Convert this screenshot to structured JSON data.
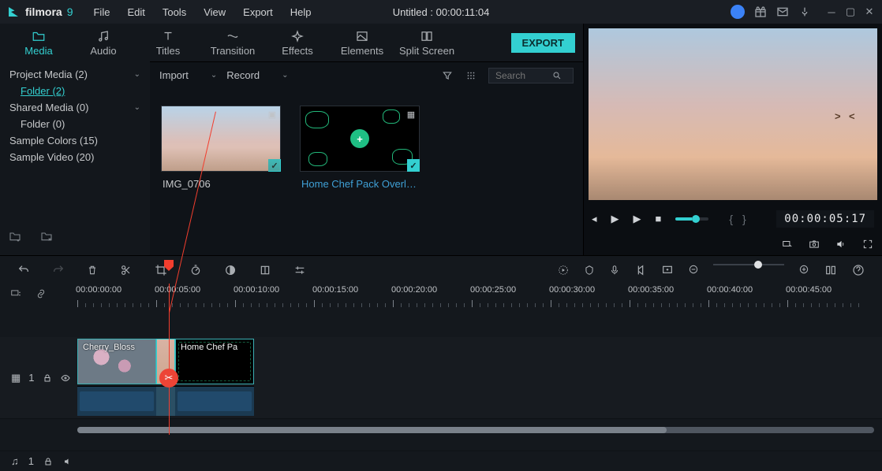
{
  "app": {
    "name": "filmora",
    "num": "9",
    "title": "Untitled : 00:00:11:04"
  },
  "menu": {
    "file": "File",
    "edit": "Edit",
    "tools": "Tools",
    "view": "View",
    "export": "Export",
    "help": "Help"
  },
  "tabs": {
    "media": "Media",
    "audio": "Audio",
    "titles": "Titles",
    "transition": "Transition",
    "effects": "Effects",
    "elements": "Elements",
    "split": "Split Screen",
    "export_btn": "EXPORT"
  },
  "sidebar": {
    "project_media": "Project Media (2)",
    "folder_sel": "Folder (2)",
    "shared_media": "Shared Media (0)",
    "folder0": "Folder (0)",
    "sample_colors": "Sample Colors (15)",
    "sample_video": "Sample Video (20)"
  },
  "mediabar": {
    "import": "Import",
    "record": "Record",
    "search_ph": "Search"
  },
  "clips": {
    "c1_name": "IMG_0706",
    "c2_name": "Home Chef Pack Overl…"
  },
  "preview": {
    "timecode": "00:00:05:17"
  },
  "timeline": {
    "marks": [
      "00:00:00:00",
      "00:00:05:00",
      "00:00:10:00",
      "00:00:15:00",
      "00:00:20:00",
      "00:00:25:00",
      "00:00:30:00",
      "00:00:35:00",
      "00:00:40:00",
      "00:00:45:00"
    ],
    "track_video": "1",
    "track_audio": "1",
    "clip_a": "Cherry_Bloss",
    "clip_b": "Home Chef Pa"
  }
}
